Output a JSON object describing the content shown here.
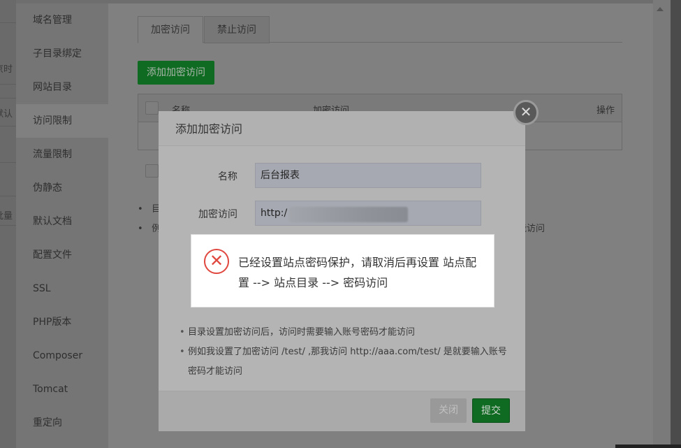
{
  "background_fragments": [
    "京时",
    "默认",
    "批量"
  ],
  "sidebar": {
    "items": [
      {
        "label": "域名管理"
      },
      {
        "label": "子目录绑定"
      },
      {
        "label": "网站目录"
      },
      {
        "label": "访问限制",
        "active": true
      },
      {
        "label": "流量限制"
      },
      {
        "label": "伪静态"
      },
      {
        "label": "默认文档"
      },
      {
        "label": "配置文件"
      },
      {
        "label": "SSL"
      },
      {
        "label": "PHP版本"
      },
      {
        "label": "Composer"
      },
      {
        "label": "Tomcat"
      },
      {
        "label": "重定向"
      }
    ]
  },
  "main": {
    "tabs": [
      {
        "label": "加密访问",
        "active": true
      },
      {
        "label": "禁止访问"
      }
    ],
    "add_button": "添加加密访问",
    "table": {
      "headers": [
        "名称",
        "加密访问",
        "操作"
      ]
    },
    "tips_partial": [
      "目",
      "例"
    ],
    "tip_tail": "才能访问"
  },
  "dialog": {
    "title": "添加加密访问",
    "fields": [
      {
        "label": "名称",
        "value": "后台报表"
      },
      {
        "label": "加密访问",
        "value": "http:/"
      }
    ],
    "tips": [
      "目录设置加密访问后，访问时需要输入账号密码才能访问",
      "例如我设置了加密访问 /test/ ,那我访问 http://aaa.com/test/ 是就要输入账号密码才能访问"
    ],
    "close_button": "关闭",
    "submit_button": "提交"
  },
  "alert": {
    "message": "已经设置站点密码保护，请取消后再设置 站点配置 --> 站点目录 --> 密码访问",
    "icon": "error-x-icon",
    "color": "#e0473e"
  },
  "colors": {
    "primary": "#20a53a"
  }
}
